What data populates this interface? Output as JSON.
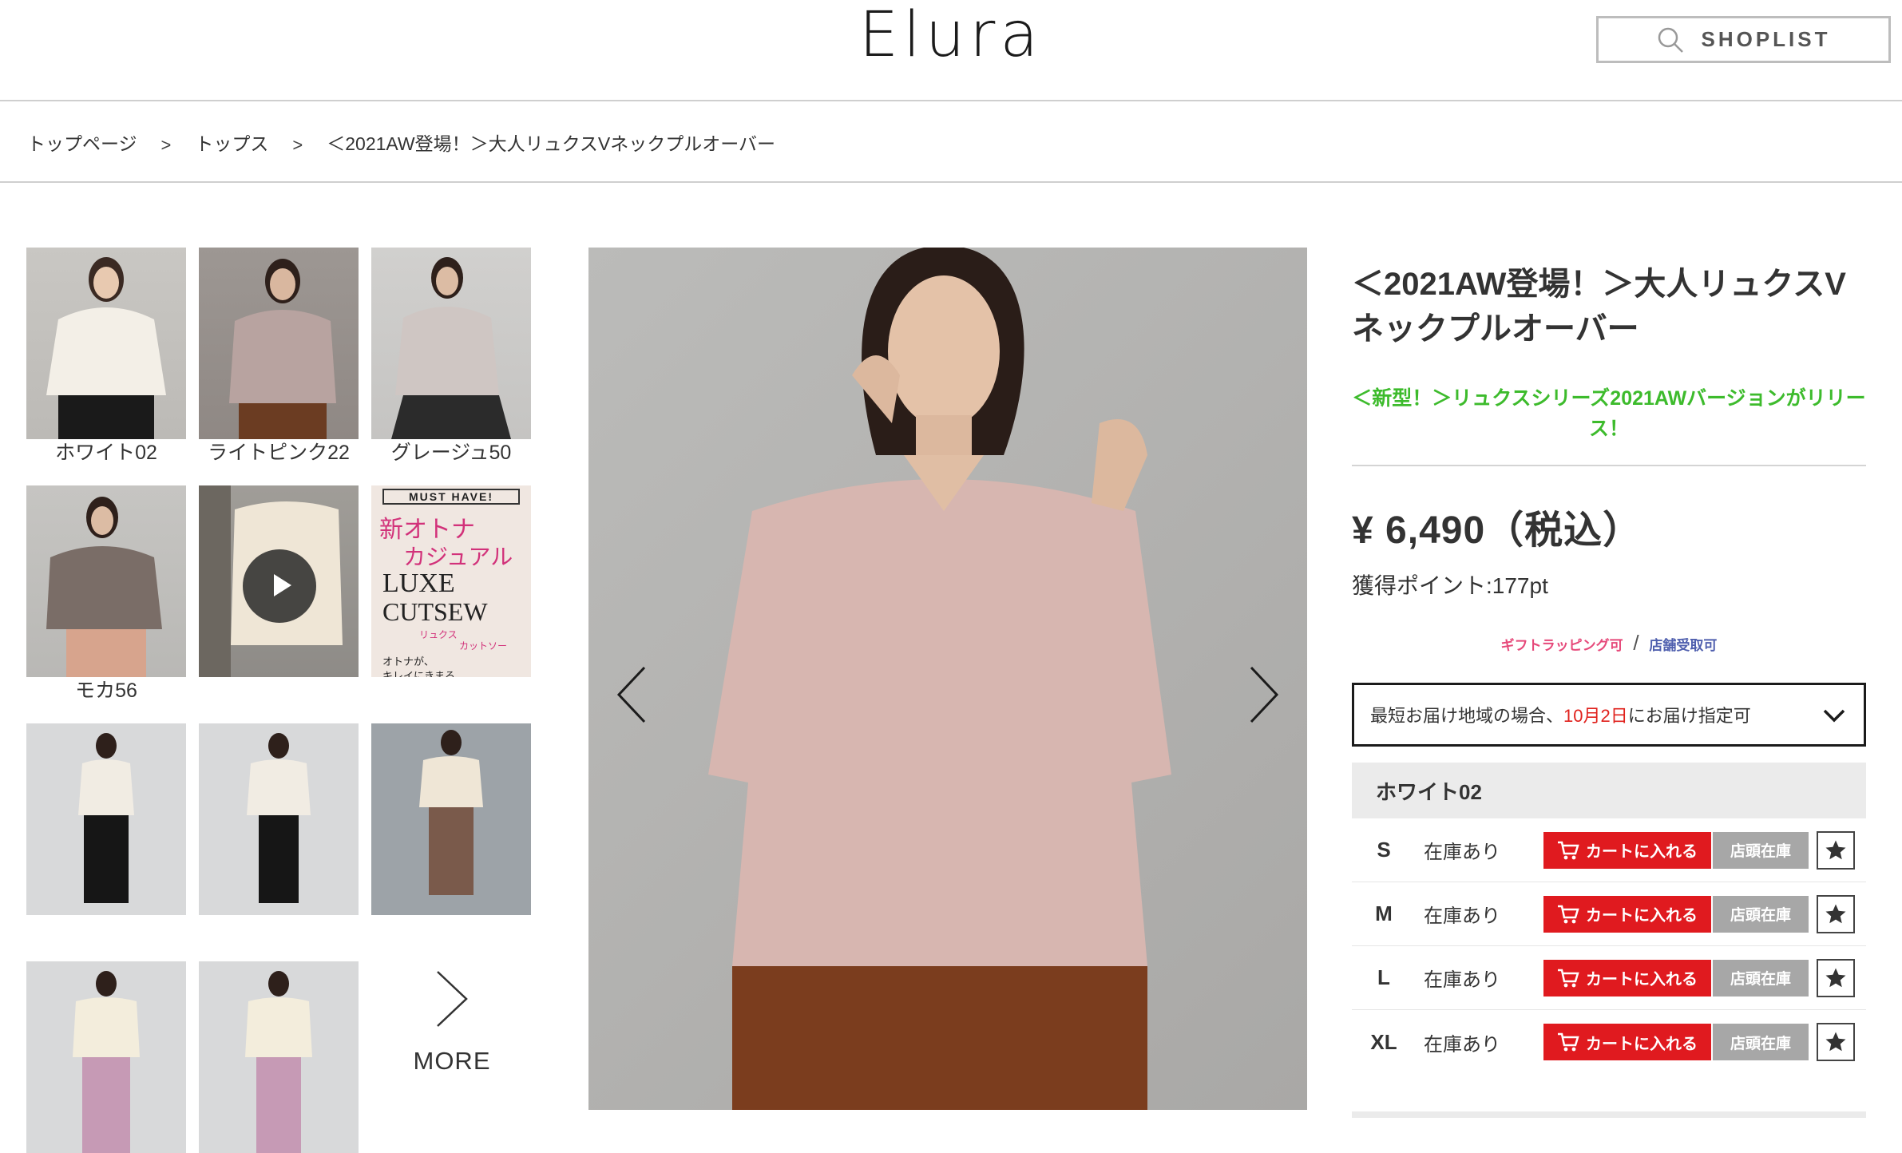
{
  "header": {
    "logo": "Elura",
    "shoplist_label": "SHOPLIST"
  },
  "breadcrumb": {
    "items": [
      "トップページ",
      "トップス",
      "＜2021AW登場！＞大人リュクスVネックプルオーバー"
    ],
    "separator": ">"
  },
  "thumbnails": {
    "items": [
      {
        "label": "ホワイト02"
      },
      {
        "label": "ライトピンク22"
      },
      {
        "label": "グレージュ50"
      },
      {
        "label": "モカ56"
      },
      {
        "label": ""
      },
      {
        "label": ""
      },
      {
        "label": ""
      },
      {
        "label": ""
      },
      {
        "label": ""
      },
      {
        "label": ""
      },
      {
        "label": ""
      }
    ],
    "promo": {
      "banner": "MUST HAVE!",
      "line1": "新オトナ",
      "line2": "カジュアル",
      "line3": "LUXE",
      "line4": "CUTSEW",
      "line5": "リュクス",
      "line6": "カットソー",
      "line7": "オトナが、",
      "line8": "キレイにきまる"
    },
    "more_label": "MORE"
  },
  "product": {
    "title": "＜2021AW登場！＞大人リュクスVネックプルオーバー",
    "subtitle": "＜新型！＞リュクスシリーズ2021AWバージョンがリリース！",
    "price": "¥ 6,490（税込）",
    "points": "獲得ポイント:177pt",
    "service_gift": "ギフトラッピング可",
    "service_sep": "/",
    "service_store": "店舗受取可",
    "delivery": {
      "prefix": "最短お届け地域の場合、",
      "date": "10月2日",
      "suffix": "にお届け指定可"
    },
    "color_name": "ホワイト02",
    "sizes": [
      {
        "size": "S",
        "stock": "在庫あり"
      },
      {
        "size": "M",
        "stock": "在庫あり"
      },
      {
        "size": "L",
        "stock": "在庫あり"
      },
      {
        "size": "XL",
        "stock": "在庫あり"
      }
    ],
    "cart_label": "カートに入れる",
    "store_stock_label": "店頭在庫"
  },
  "colors": {
    "accent_red": "#e01a1f",
    "subtitle_green": "#3dbb2c",
    "gift_pink": "#e6497a",
    "store_blue": "#4f5fae"
  }
}
